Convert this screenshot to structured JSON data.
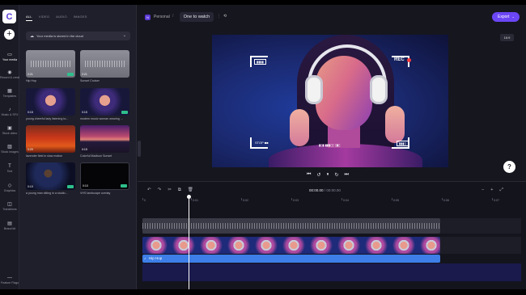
{
  "rail": {
    "items": [
      {
        "icon": "▭",
        "label": "Your media"
      },
      {
        "icon": "◉",
        "label": "Record & create"
      },
      {
        "icon": "▦",
        "label": "Templates"
      },
      {
        "icon": "♪",
        "label": "Music & SFX"
      },
      {
        "icon": "▣",
        "label": "Stock video"
      },
      {
        "icon": "▨",
        "label": "Stock images"
      },
      {
        "icon": "T",
        "label": "Text"
      },
      {
        "icon": "◇",
        "label": "Graphics"
      },
      {
        "icon": "◫",
        "label": "Transitions"
      },
      {
        "icon": "▤",
        "label": "Brand kit"
      },
      {
        "icon": "—",
        "label": "Feature Flags"
      }
    ]
  },
  "panel": {
    "tabs": [
      "ALL",
      "VIDEO",
      "AUDIO",
      "IMAGES"
    ],
    "cloud_text": "Your media is stored in the cloud",
    "media": [
      {
        "caption": "Hip Hop",
        "duration": "2:21",
        "badge": true
      },
      {
        "caption": "Sunset Cruiser",
        "duration": "2:21",
        "badge": false
      },
      {
        "caption": "young cheerful lady listening to...",
        "duration": "0:15",
        "badge": false
      },
      {
        "caption": "modern music woman wearing ...",
        "duration": "0:15",
        "badge": true
      },
      {
        "caption": "lavender field in slow motion",
        "duration": "0:20",
        "badge": false
      },
      {
        "caption": "Colorful Madison Sunset",
        "duration": "0:15",
        "badge": false
      },
      {
        "caption": "a young man sitting in a studio...",
        "duration": "0:10",
        "badge": true
      },
      {
        "caption": "VHS landscape overlay",
        "duration": "0:10",
        "badge": true
      }
    ]
  },
  "topbar": {
    "workspace_initial": "N",
    "workspace": "Personal",
    "project_title": "One to watch",
    "export_label": "Export"
  },
  "stage": {
    "ratio": "16:9",
    "overlay": {
      "rec": "REC",
      "battery": "▮▮▮▯",
      "top_tag": "▮▮▮▮",
      "stop": "STOP ■■",
      "signal": "▮▯▮ ▮▮▮▯▯ ▯▮▯"
    },
    "controls": [
      "⏮",
      "↺",
      "⏸",
      "↻",
      "⏭"
    ],
    "help": "?"
  },
  "timeline": {
    "tools": [
      "↶",
      "↷",
      "✂",
      "⧉",
      "🗑"
    ],
    "timecode_current": "00:00.00",
    "timecode_total": "00:00.00",
    "zoom": [
      "−",
      "+",
      "⤢"
    ],
    "ticks": [
      "0",
      "0:01",
      "0:02",
      "0:03",
      "0:04",
      "0:05",
      "0:06",
      "0:07"
    ],
    "audio_label": "Hip Hop"
  }
}
